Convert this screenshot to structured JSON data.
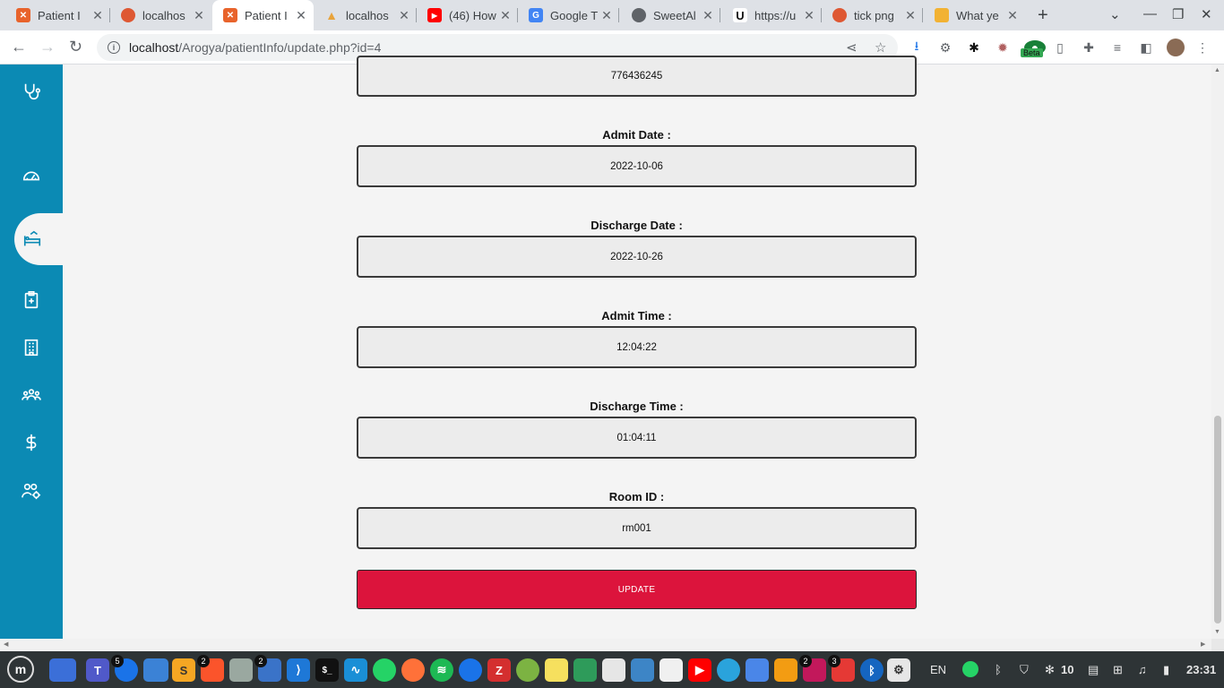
{
  "browser": {
    "tabs": [
      {
        "title": "Patient I",
        "favicon_color": "#e8632b",
        "favicon_glyph": "⌘"
      },
      {
        "title": "localhos",
        "favicon_color": "#de5833",
        "favicon_glyph": "◉"
      },
      {
        "title": "Patient I",
        "favicon_color": "#e8632b",
        "favicon_glyph": "⌘"
      },
      {
        "title": "localhos",
        "favicon_color": "#e8a33b",
        "favicon_glyph": "▲"
      },
      {
        "title": "(46) How",
        "favicon_color": "#ff0000",
        "favicon_glyph": "▶"
      },
      {
        "title": "Google T",
        "favicon_color": "#4285f4",
        "favicon_glyph": "G"
      },
      {
        "title": "SweetAl",
        "favicon_color": "#5f6368",
        "favicon_glyph": "◎"
      },
      {
        "title": "https://u",
        "favicon_color": "#111111",
        "favicon_glyph": "U"
      },
      {
        "title": "tick png",
        "favicon_color": "#de5833",
        "favicon_glyph": "◉"
      },
      {
        "title": "What ye",
        "favicon_color": "#f2b233",
        "favicon_glyph": "▦"
      }
    ],
    "close_glyph": "✕",
    "new_tab_glyph": "+",
    "window_controls": [
      "⌄",
      "—",
      "❐",
      "✕"
    ],
    "url_host": "localhost",
    "url_path": "/Arogya/patientInfo/update.php?id=4",
    "extension_badge": "Beta"
  },
  "form": {
    "top_value": "776436245",
    "fields": [
      {
        "label": "Admit Date :",
        "value": "2022-10-06"
      },
      {
        "label": "Discharge Date :",
        "value": "2022-10-26"
      },
      {
        "label": "Admit Time :",
        "value": "12:04:22"
      },
      {
        "label": "Discharge Time :",
        "value": "01:04:11"
      },
      {
        "label": "Room ID :",
        "value": "rm001"
      }
    ],
    "submit_label": "UPDATE"
  },
  "colors": {
    "sidebar": "#0b8ab4",
    "update_button": "#dc143c"
  },
  "sidebar_icons": [
    "stethoscope-icon",
    "dashboard-icon",
    "bed-icon",
    "clipboard-plus-icon",
    "hospital-building-icon",
    "team-icon",
    "dollar-icon",
    "user-settings-icon"
  ],
  "taskbar": {
    "badges": {
      "chrome": "5",
      "brave": "2",
      "notes": "2",
      "photos": "2",
      "reader": "3"
    },
    "language": "EN",
    "weather": "10",
    "clock": "23:31"
  }
}
